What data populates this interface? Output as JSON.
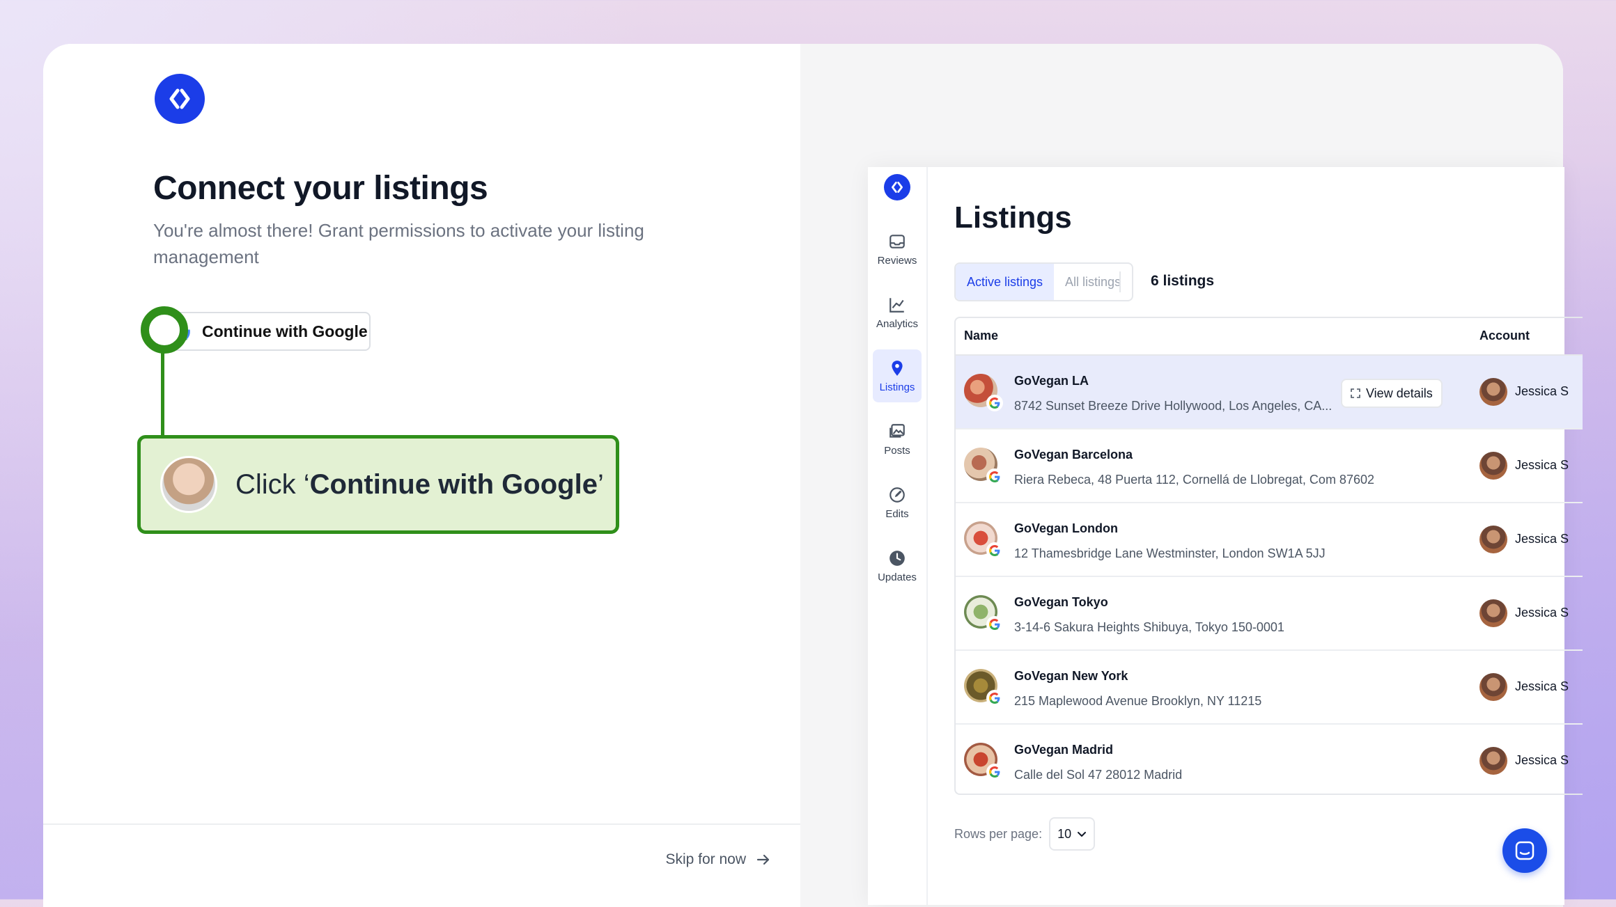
{
  "onboarding": {
    "heading": "Connect your listings",
    "subheading": "You're almost there! Grant permissions to activate your listing management",
    "google_button_label": "Continue with Google",
    "skip_label": "Skip for now"
  },
  "callout": {
    "prefix": "Click ‘",
    "emphasis": "Continue with Google",
    "suffix": "’",
    "accent_color": "#2f8f1a"
  },
  "app": {
    "brand_color": "#1b3de8",
    "nav": [
      {
        "label": "Reviews",
        "icon": "inbox-icon"
      },
      {
        "label": "Analytics",
        "icon": "chart-icon"
      },
      {
        "label": "Listings",
        "icon": "map-pin-icon",
        "active": true
      },
      {
        "label": "Posts",
        "icon": "images-icon"
      },
      {
        "label": "Edits",
        "icon": "edit-icon"
      },
      {
        "label": "Updates",
        "icon": "clock-icon"
      }
    ],
    "title": "Listings",
    "tabs": [
      {
        "label": "Active listings",
        "active": true
      },
      {
        "label": "All listings",
        "active": false
      }
    ],
    "count_label": "6 listings",
    "columns": {
      "name": "Name",
      "account": "Account"
    },
    "rows": [
      {
        "name": "GoVegan LA",
        "address": "8742 Sunset Breeze Drive Hollywood, Los Angeles, CA...",
        "account": "Jessica S",
        "highlighted": true
      },
      {
        "name": "GoVegan Barcelona",
        "address": "Riera Rebeca, 48 Puerta 112, Cornellá de Llobregat, Com 87602",
        "account": "Jessica S"
      },
      {
        "name": "GoVegan London",
        "address": "12 Thamesbridge Lane Westminster, London SW1A 5JJ",
        "account": "Jessica S"
      },
      {
        "name": "GoVegan Tokyo",
        "address": "3-14-6 Sakura Heights Shibuya, Tokyo 150-0001",
        "account": "Jessica S"
      },
      {
        "name": "GoVegan New York",
        "address": "215 Maplewood Avenue Brooklyn, NY 11215",
        "account": "Jessica S"
      },
      {
        "name": "GoVegan Madrid",
        "address": "Calle del Sol 47 28012 Madrid",
        "account": "Jessica S"
      }
    ],
    "view_details_label": "View details",
    "rows_per_page_label": "Rows per page:",
    "rows_per_page_value": "10"
  }
}
